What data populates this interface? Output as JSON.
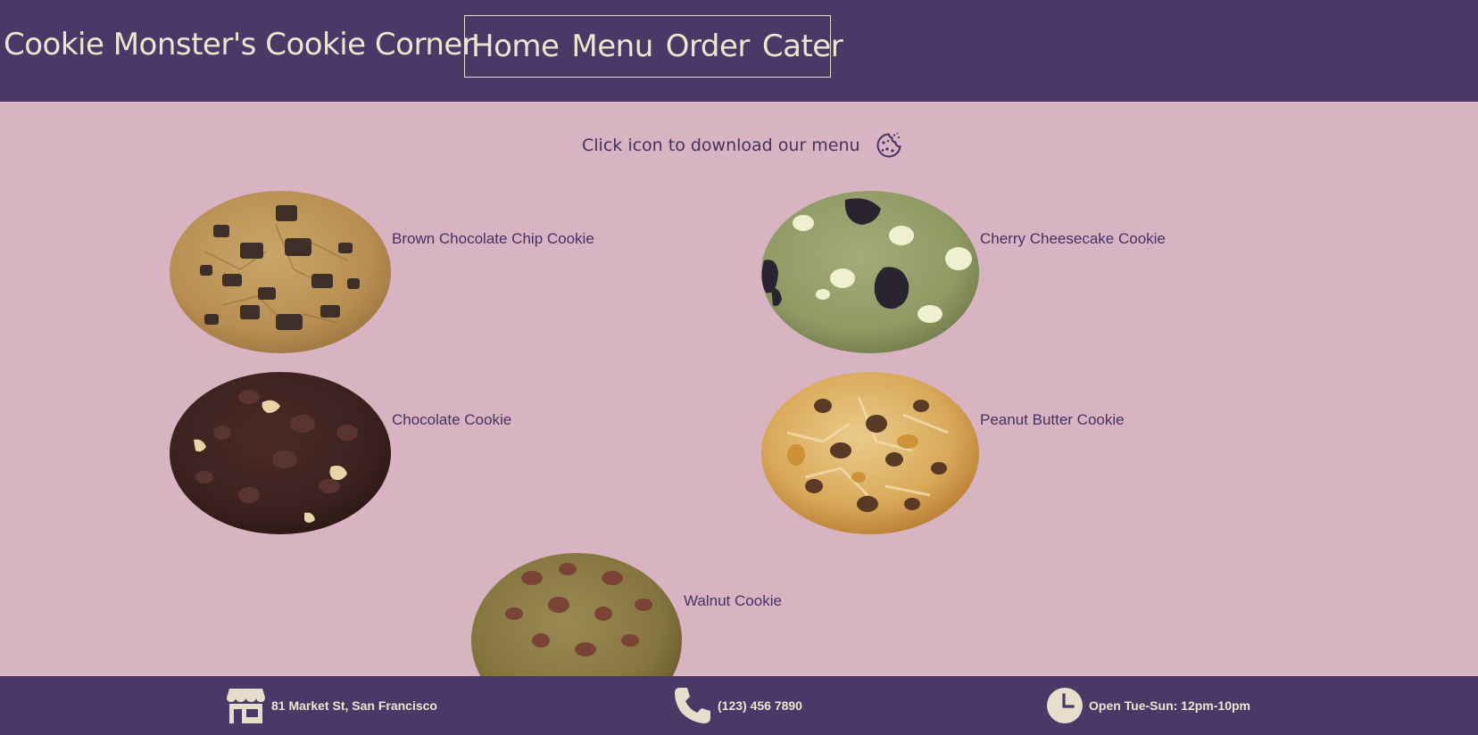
{
  "header": {
    "brand": "Cookie Monster's Cookie Corner",
    "nav": [
      "Home",
      "Menu",
      "Order",
      "Cater"
    ]
  },
  "download": {
    "text": "Click icon to download our menu",
    "icon": "cookie-icon"
  },
  "cookies": [
    {
      "name": "Brown Chocolate Chip Cookie",
      "image": "brown-chocolate-chip-cookie-photo"
    },
    {
      "name": "Cherry Cheesecake Cookie",
      "image": "cherry-cheesecake-cookie-photo"
    },
    {
      "name": "Chocolate Cookie",
      "image": "chocolate-cookie-photo"
    },
    {
      "name": "Peanut Butter Cookie",
      "image": "peanut-butter-cookie-photo"
    },
    {
      "name": "Walnut Cookie",
      "image": "walnut-cookie-photo"
    }
  ],
  "footer": {
    "address": "81 Market St, San Francisco",
    "phone": "(123) 456 7890",
    "hours": "Open Tue-Sun: 12pm-10pm",
    "icons": [
      "storefront-icon",
      "phone-icon",
      "clock-icon"
    ]
  },
  "colors": {
    "header_bg": "#4a3966",
    "page_bg": "#d8b4c3",
    "header_text": "#f0e4d0",
    "body_text": "#45325f"
  }
}
